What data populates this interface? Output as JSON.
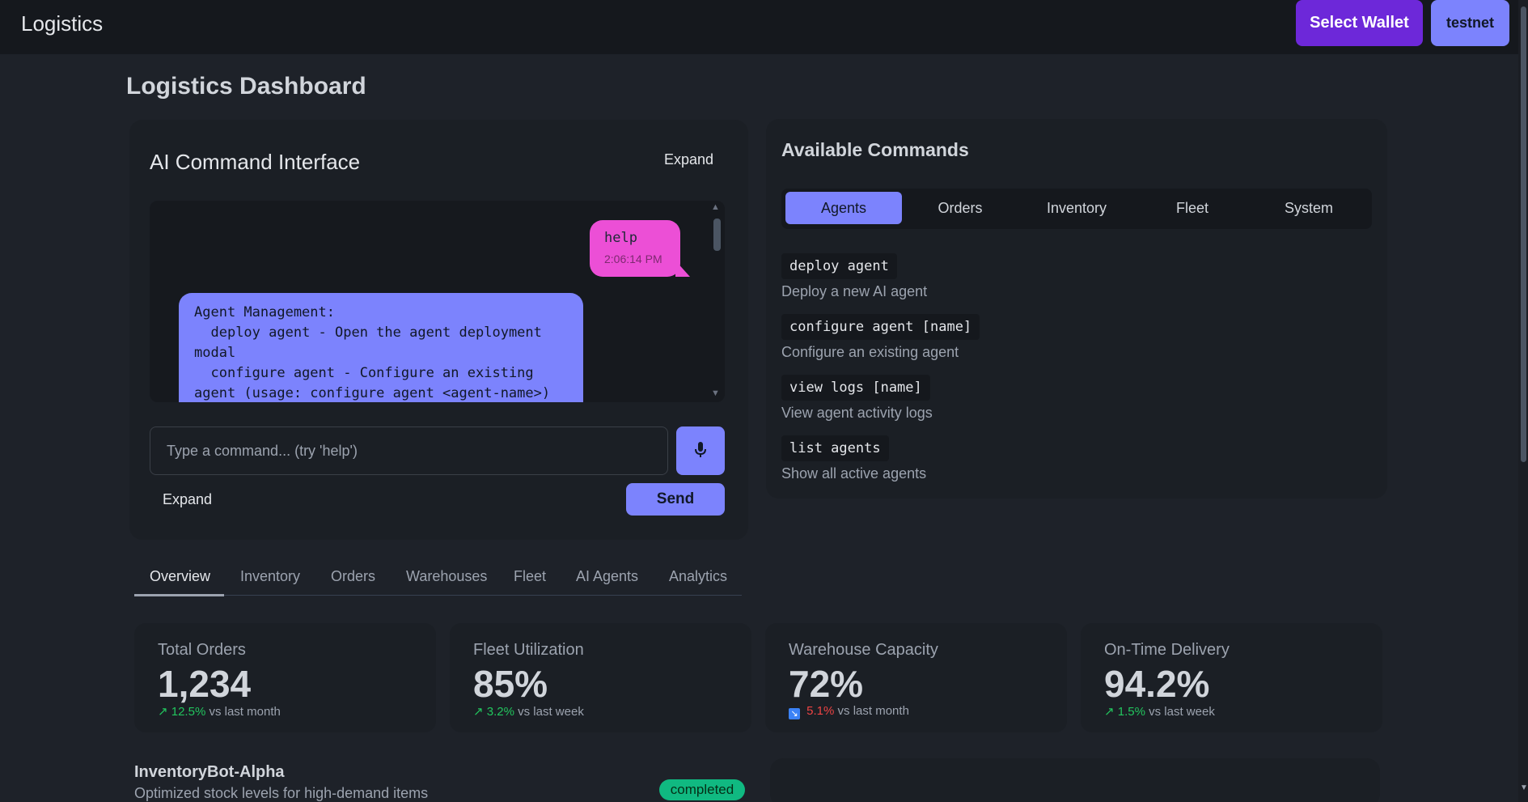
{
  "header": {
    "brand": "Logistics",
    "select_wallet": "Select Wallet",
    "network": "testnet"
  },
  "page": {
    "title": "Logistics Dashboard"
  },
  "ai_interface": {
    "title": "AI Command Interface",
    "expand_top": "Expand",
    "user_message": {
      "text": "help",
      "time": "2:06:14 PM"
    },
    "ai_message": "Agent Management:\n  deploy agent - Open the agent deployment modal\n  configure agent - Configure an existing agent (usage: configure agent <agent-name>)",
    "input_placeholder": "Type a command... (try 'help')",
    "expand_bottom": "Expand",
    "send_label": "Send"
  },
  "commands": {
    "title": "Available Commands",
    "tabs": [
      "Agents",
      "Orders",
      "Inventory",
      "Fleet",
      "System"
    ],
    "active_tab": "Agents",
    "items": [
      {
        "code": "deploy agent",
        "desc": "Deploy a new AI agent"
      },
      {
        "code": "configure agent [name]",
        "desc": "Configure an existing agent"
      },
      {
        "code": "view logs [name]",
        "desc": "View agent activity logs"
      },
      {
        "code": "list agents",
        "desc": "Show all active agents"
      }
    ]
  },
  "main_tabs": [
    "Overview",
    "Inventory",
    "Orders",
    "Warehouses",
    "Fleet",
    "AI Agents",
    "Analytics"
  ],
  "stats": [
    {
      "label": "Total Orders",
      "value": "1,234",
      "arrow": "↗",
      "change": "12.5%",
      "trend": "up",
      "period": "vs last month"
    },
    {
      "label": "Fleet Utilization",
      "value": "85%",
      "arrow": "↗",
      "change": "3.2%",
      "trend": "up",
      "period": "vs last week"
    },
    {
      "label": "Warehouse Capacity",
      "value": "72%",
      "arrow": "↘",
      "change": "5.1%",
      "trend": "down",
      "period": "vs last month"
    },
    {
      "label": "On-Time Delivery",
      "value": "94.2%",
      "arrow": "↗",
      "change": "1.5%",
      "trend": "up",
      "period": "vs last week"
    }
  ],
  "agent_activity": {
    "name": "InventoryBot-Alpha",
    "description": "Optimized stock levels for high-demand items",
    "status": "completed"
  },
  "colors": {
    "accent": "#7c83fd",
    "wallet": "#6d28d9",
    "user_bubble": "#ec4fd6",
    "success": "#10b981"
  }
}
